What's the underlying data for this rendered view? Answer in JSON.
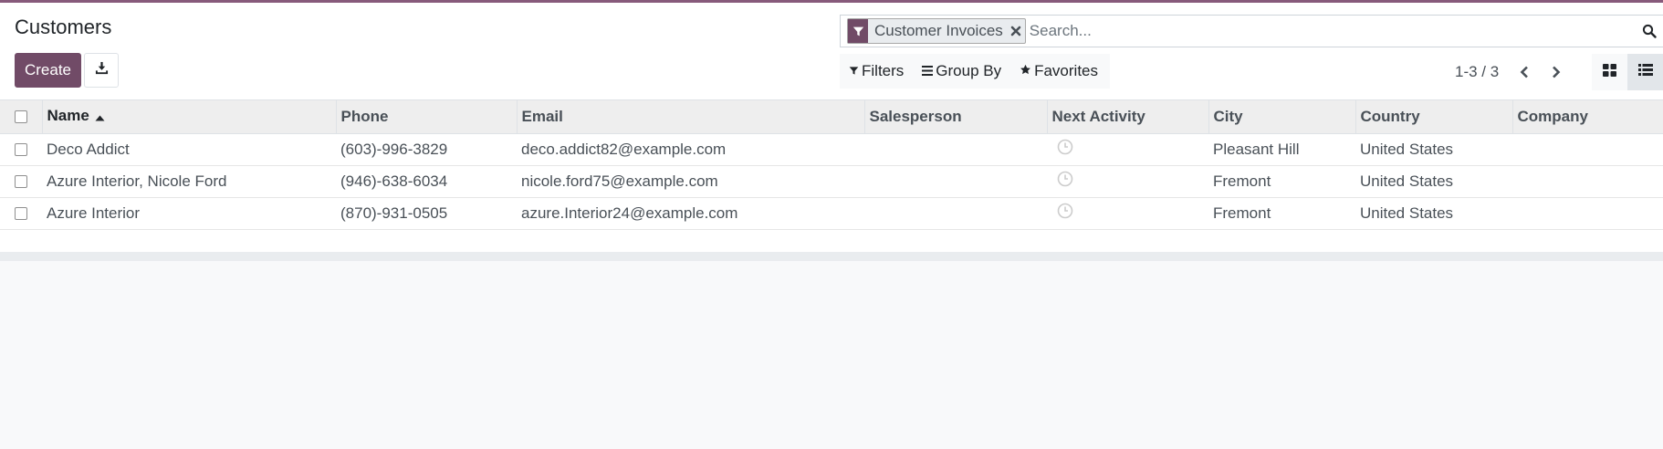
{
  "page": {
    "title": "Customers"
  },
  "colors": {
    "brand": "#714b67",
    "accent_line": "#875a7b"
  },
  "toolbar": {
    "create_label": "Create",
    "download_icon": "download-icon"
  },
  "search": {
    "facet_icon": "filter-icon",
    "facet_label": "Customer Invoices",
    "placeholder": "Search...",
    "search_icon": "search-icon"
  },
  "filters": {
    "filters_label": "Filters",
    "group_by_label": "Group By",
    "favorites_label": "Favorites"
  },
  "pager": {
    "value": "1-3 / 3"
  },
  "view_switcher": {
    "views": [
      "kanban",
      "list"
    ],
    "active": "list"
  },
  "list": {
    "columns": [
      "Name",
      "Phone",
      "Email",
      "Salesperson",
      "Next Activity",
      "City",
      "Country",
      "Company"
    ],
    "sort_column": "Name",
    "sort_direction": "ascending",
    "rows": [
      {
        "name": "Deco Addict",
        "phone": "(603)-996-3829",
        "email": "deco.addict82@example.com",
        "salesperson": "",
        "next_activity": "clock-icon",
        "city": "Pleasant Hill",
        "country": "United States",
        "company": ""
      },
      {
        "name": "Azure Interior, Nicole Ford",
        "phone": "(946)-638-6034",
        "email": "nicole.ford75@example.com",
        "salesperson": "",
        "next_activity": "clock-icon",
        "city": "Fremont",
        "country": "United States",
        "company": ""
      },
      {
        "name": "Azure Interior",
        "phone": "(870)-931-0505",
        "email": "azure.Interior24@example.com",
        "salesperson": "",
        "next_activity": "clock-icon",
        "city": "Fremont",
        "country": "United States",
        "company": ""
      }
    ]
  }
}
